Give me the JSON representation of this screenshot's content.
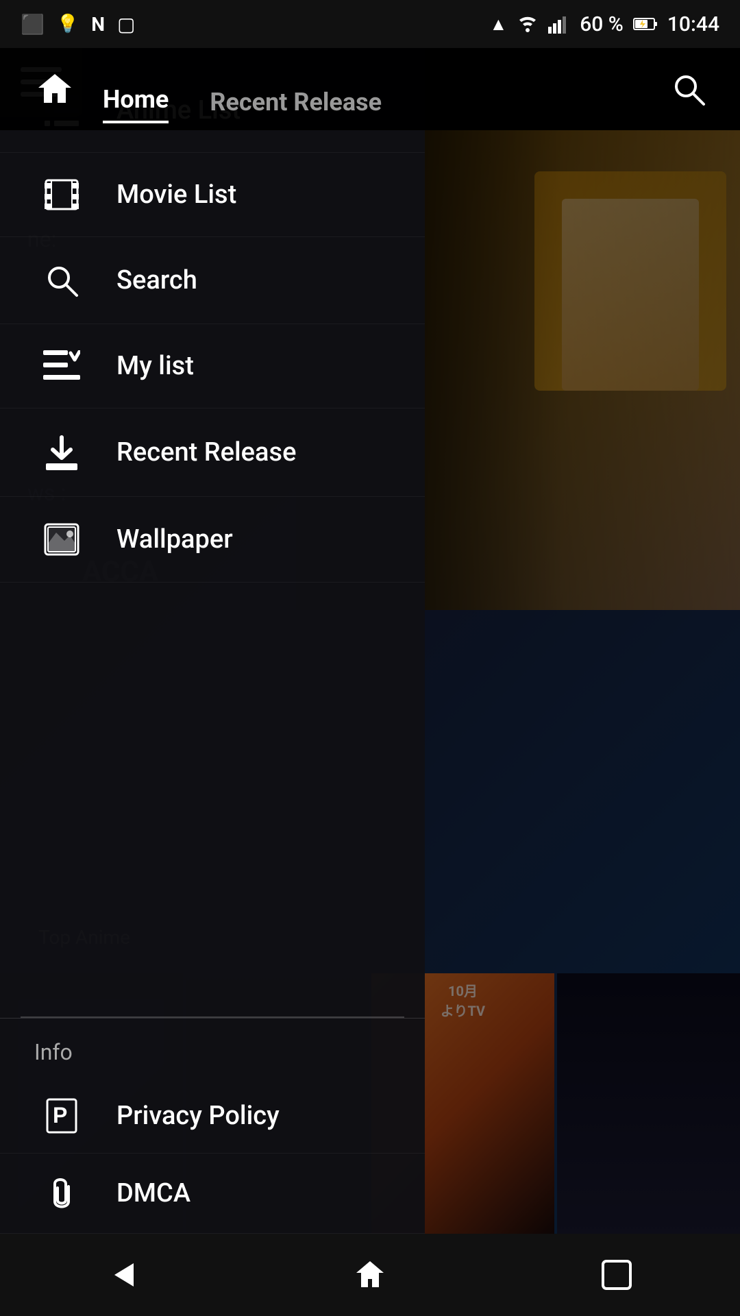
{
  "statusBar": {
    "time": "10:44",
    "battery": "60 %",
    "icons": [
      "bluetooth",
      "wifi",
      "signal",
      "battery"
    ]
  },
  "topNav": {
    "tabs": [
      {
        "label": "Home",
        "active": true
      },
      {
        "label": "Recent Release",
        "active": false
      }
    ],
    "searchIcon": "search"
  },
  "drawer": {
    "menuItems": [
      {
        "id": "anime-list",
        "label": "Anime List",
        "icon": "list"
      },
      {
        "id": "movie-list",
        "label": "Movie List",
        "icon": "film"
      },
      {
        "id": "search",
        "label": "Search",
        "icon": "search"
      },
      {
        "id": "my-list",
        "label": "My list",
        "icon": "my-list"
      },
      {
        "id": "recent-release",
        "label": "Recent Release",
        "icon": "download"
      },
      {
        "id": "wallpaper",
        "label": "Wallpaper",
        "icon": "wallpaper"
      }
    ],
    "infoSection": {
      "label": "Info"
    },
    "infoItems": [
      {
        "id": "privacy-policy",
        "label": "Privacy Policy",
        "icon": "parking"
      },
      {
        "id": "dmca",
        "label": "DMCA",
        "icon": "paperclip"
      }
    ]
  },
  "backgroundText": {
    "ne": "ne:",
    "ws": "ws :",
    "acca": "ACCA"
  },
  "chips": {
    "topAnime": "Top Anime"
  },
  "bottomNav": {
    "back": "◁",
    "home": "⌂",
    "recents": "□"
  }
}
